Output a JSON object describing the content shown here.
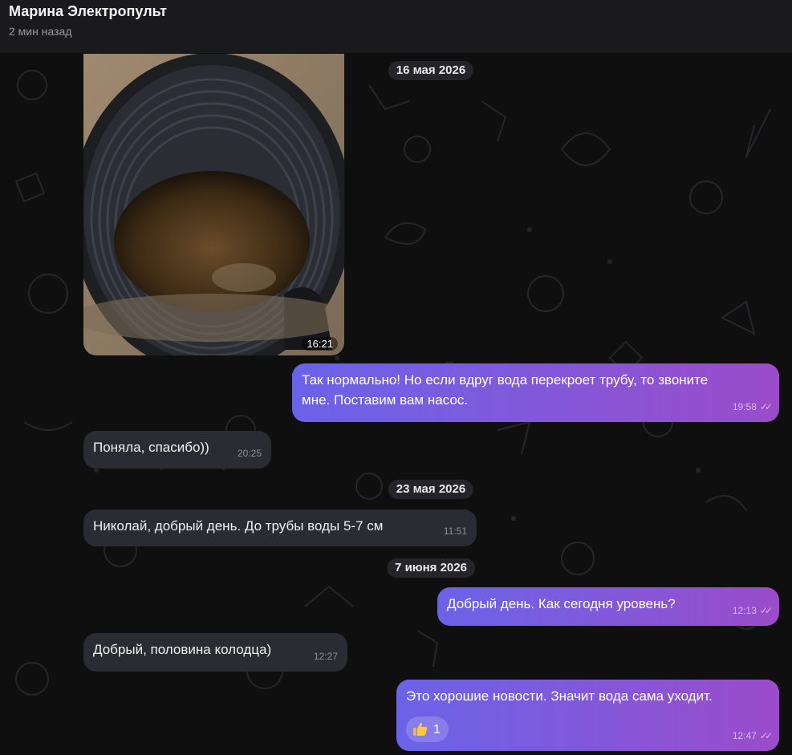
{
  "header": {
    "name": "Марина Электропульт",
    "status": "2 мин назад"
  },
  "messages": {
    "photo_time": "16:21",
    "date1": "16 мая 2026",
    "m1_text": "Так нормально! Но если вдруг вода перекроет трубу, то звоните мне. Поставим вам насос.",
    "m1_time": "19:58",
    "m2_text": "Поняла, спасибо))",
    "m2_time": "20:25",
    "date2": "23 мая 2026",
    "m3_text": "Николай, добрый день. До трубы воды 5-7 см",
    "m3_time": "11:51",
    "date3": "7 июня 2026",
    "m4_text": "Добрый день. Как сегодня уровень?",
    "m4_time": "12:13",
    "m5_text": "Добрый, половина колодца)",
    "m5_time": "12:27",
    "m6_text": "Это хорошие новости. Значит вода сама уходит.",
    "m6_time": "12:47",
    "m6_reaction_count": "1"
  },
  "colors": {
    "outgoing_start": "#6a63e8",
    "outgoing_end": "#9b4cc9",
    "incoming": "#2b2b33"
  },
  "icons": {
    "read_status": "double-check-icon",
    "reaction": "thumbs-up-icon"
  }
}
